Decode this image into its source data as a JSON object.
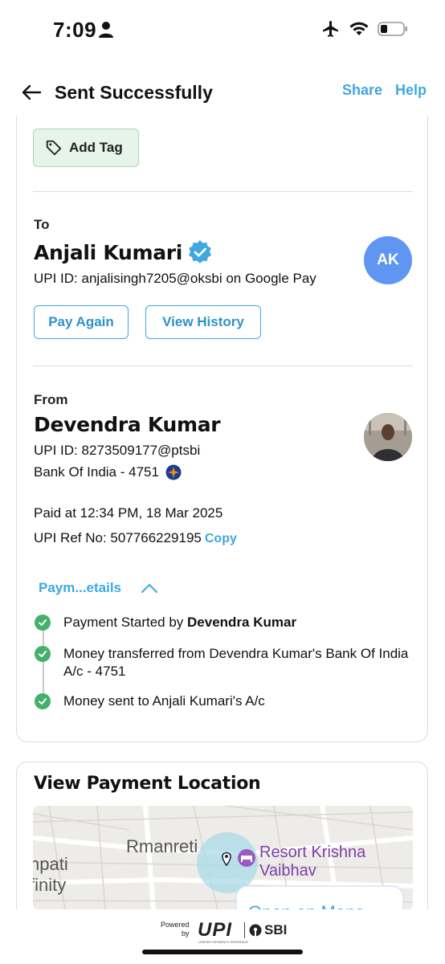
{
  "status_bar": {
    "time": "7:09"
  },
  "header": {
    "title": "Sent Successfully",
    "share": "Share",
    "help": "Help"
  },
  "tag": {
    "label": "Add Tag"
  },
  "to": {
    "label": "To",
    "name": "Anjali Kumari",
    "upi_id": "UPI ID: anjalisingh7205@oksbi on Google Pay",
    "avatar_initials": "AK",
    "pay_again": "Pay Again",
    "view_history": "View History"
  },
  "from": {
    "label": "From",
    "name": "Devendra Kumar",
    "upi_id": "UPI ID: 8273509177@ptsbi",
    "bank": "Bank Of India - 4751"
  },
  "payment": {
    "paid_at": "Paid at 12:34 PM, 18 Mar 2025",
    "ref": "UPI Ref No: 507766229195",
    "copy": "Copy"
  },
  "details": {
    "toggle": "Paym...etails",
    "steps": [
      {
        "prefix": "Payment Started by ",
        "bold": "Devendra Kumar"
      },
      {
        "prefix": "Money transferred from Devendra Kumar's Bank Of India A/c - 4751",
        "bold": ""
      },
      {
        "prefix": "Money sent to Anjali Kumari's A/c",
        "bold": ""
      }
    ]
  },
  "location": {
    "title": "View Payment Location",
    "place_left": "Rmanreti",
    "place_partial_1": "npati",
    "place_partial_2": "finity",
    "resort_line1": "Resort Krishna",
    "resort_line2": "Vaibhav",
    "open_maps": "Open on Maps"
  },
  "footer": {
    "powered": "Powered",
    "by": "by",
    "upi": "UPI",
    "upi_sub": "UNIFIED PAYMENTS INTERFACE",
    "sbi": "SBI"
  },
  "colors": {
    "accent": "#3fa8e0",
    "success": "#45b06a",
    "avatar": "#5e96f2",
    "tag_bg": "#e7f4ea"
  }
}
